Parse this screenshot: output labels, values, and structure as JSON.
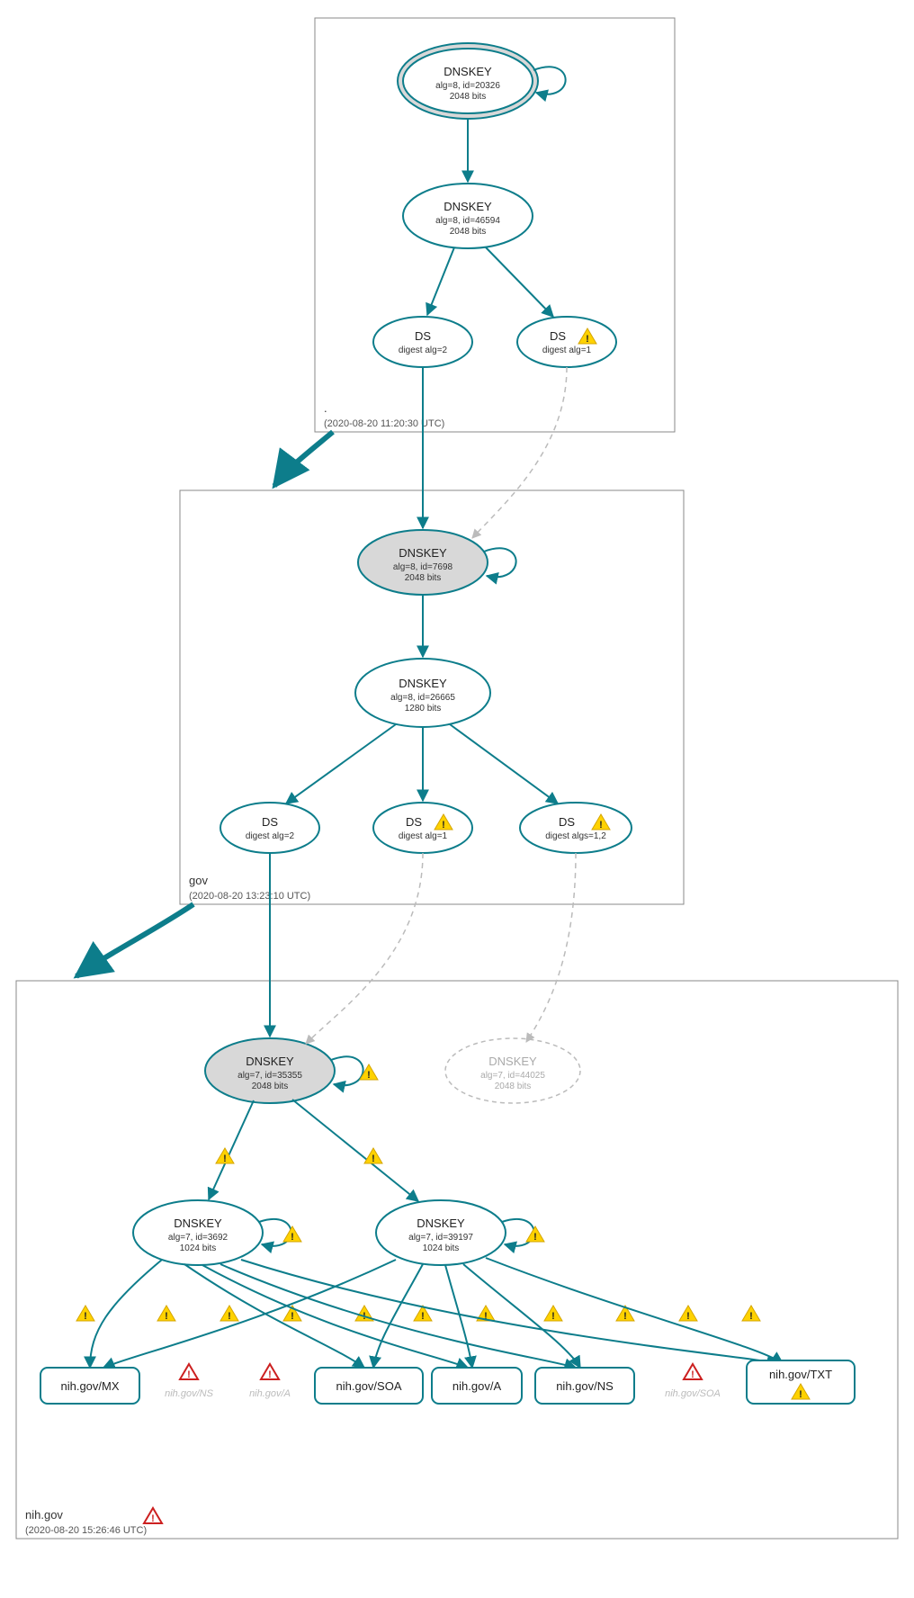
{
  "zones": {
    "root": {
      "label": ".",
      "timestamp": "(2020-08-20 11:20:30 UTC)"
    },
    "gov": {
      "label": "gov",
      "timestamp": "(2020-08-20 13:23:10 UTC)"
    },
    "nih": {
      "label": "nih.gov",
      "timestamp": "(2020-08-20 15:26:46 UTC)"
    }
  },
  "nodes": {
    "root_ksk": {
      "title": "DNSKEY",
      "sub1": "alg=8, id=20326",
      "sub2": "2048 bits"
    },
    "root_zsk": {
      "title": "DNSKEY",
      "sub1": "alg=8, id=46594",
      "sub2": "2048 bits"
    },
    "root_ds1": {
      "title": "DS",
      "sub1": "digest alg=2"
    },
    "root_ds2": {
      "title": "DS",
      "sub1": "digest alg=1"
    },
    "gov_ksk": {
      "title": "DNSKEY",
      "sub1": "alg=8, id=7698",
      "sub2": "2048 bits"
    },
    "gov_zsk": {
      "title": "DNSKEY",
      "sub1": "alg=8, id=26665",
      "sub2": "1280 bits"
    },
    "gov_ds1": {
      "title": "DS",
      "sub1": "digest alg=2"
    },
    "gov_ds2": {
      "title": "DS",
      "sub1": "digest alg=1"
    },
    "gov_ds3": {
      "title": "DS",
      "sub1": "digest algs=1,2"
    },
    "nih_ksk": {
      "title": "DNSKEY",
      "sub1": "alg=7, id=35355",
      "sub2": "2048 bits"
    },
    "nih_ghost": {
      "title": "DNSKEY",
      "sub1": "alg=7, id=44025",
      "sub2": "2048 bits"
    },
    "nih_zsk1": {
      "title": "DNSKEY",
      "sub1": "alg=7, id=3692",
      "sub2": "1024 bits"
    },
    "nih_zsk2": {
      "title": "DNSKEY",
      "sub1": "alg=7, id=39197",
      "sub2": "1024 bits"
    }
  },
  "records": {
    "mx": "nih.gov/MX",
    "ns_g": "nih.gov/NS",
    "a_g": "nih.gov/A",
    "soa": "nih.gov/SOA",
    "a": "nih.gov/A",
    "ns": "nih.gov/NS",
    "soa_g": "nih.gov/SOA",
    "txt": "nih.gov/TXT"
  }
}
